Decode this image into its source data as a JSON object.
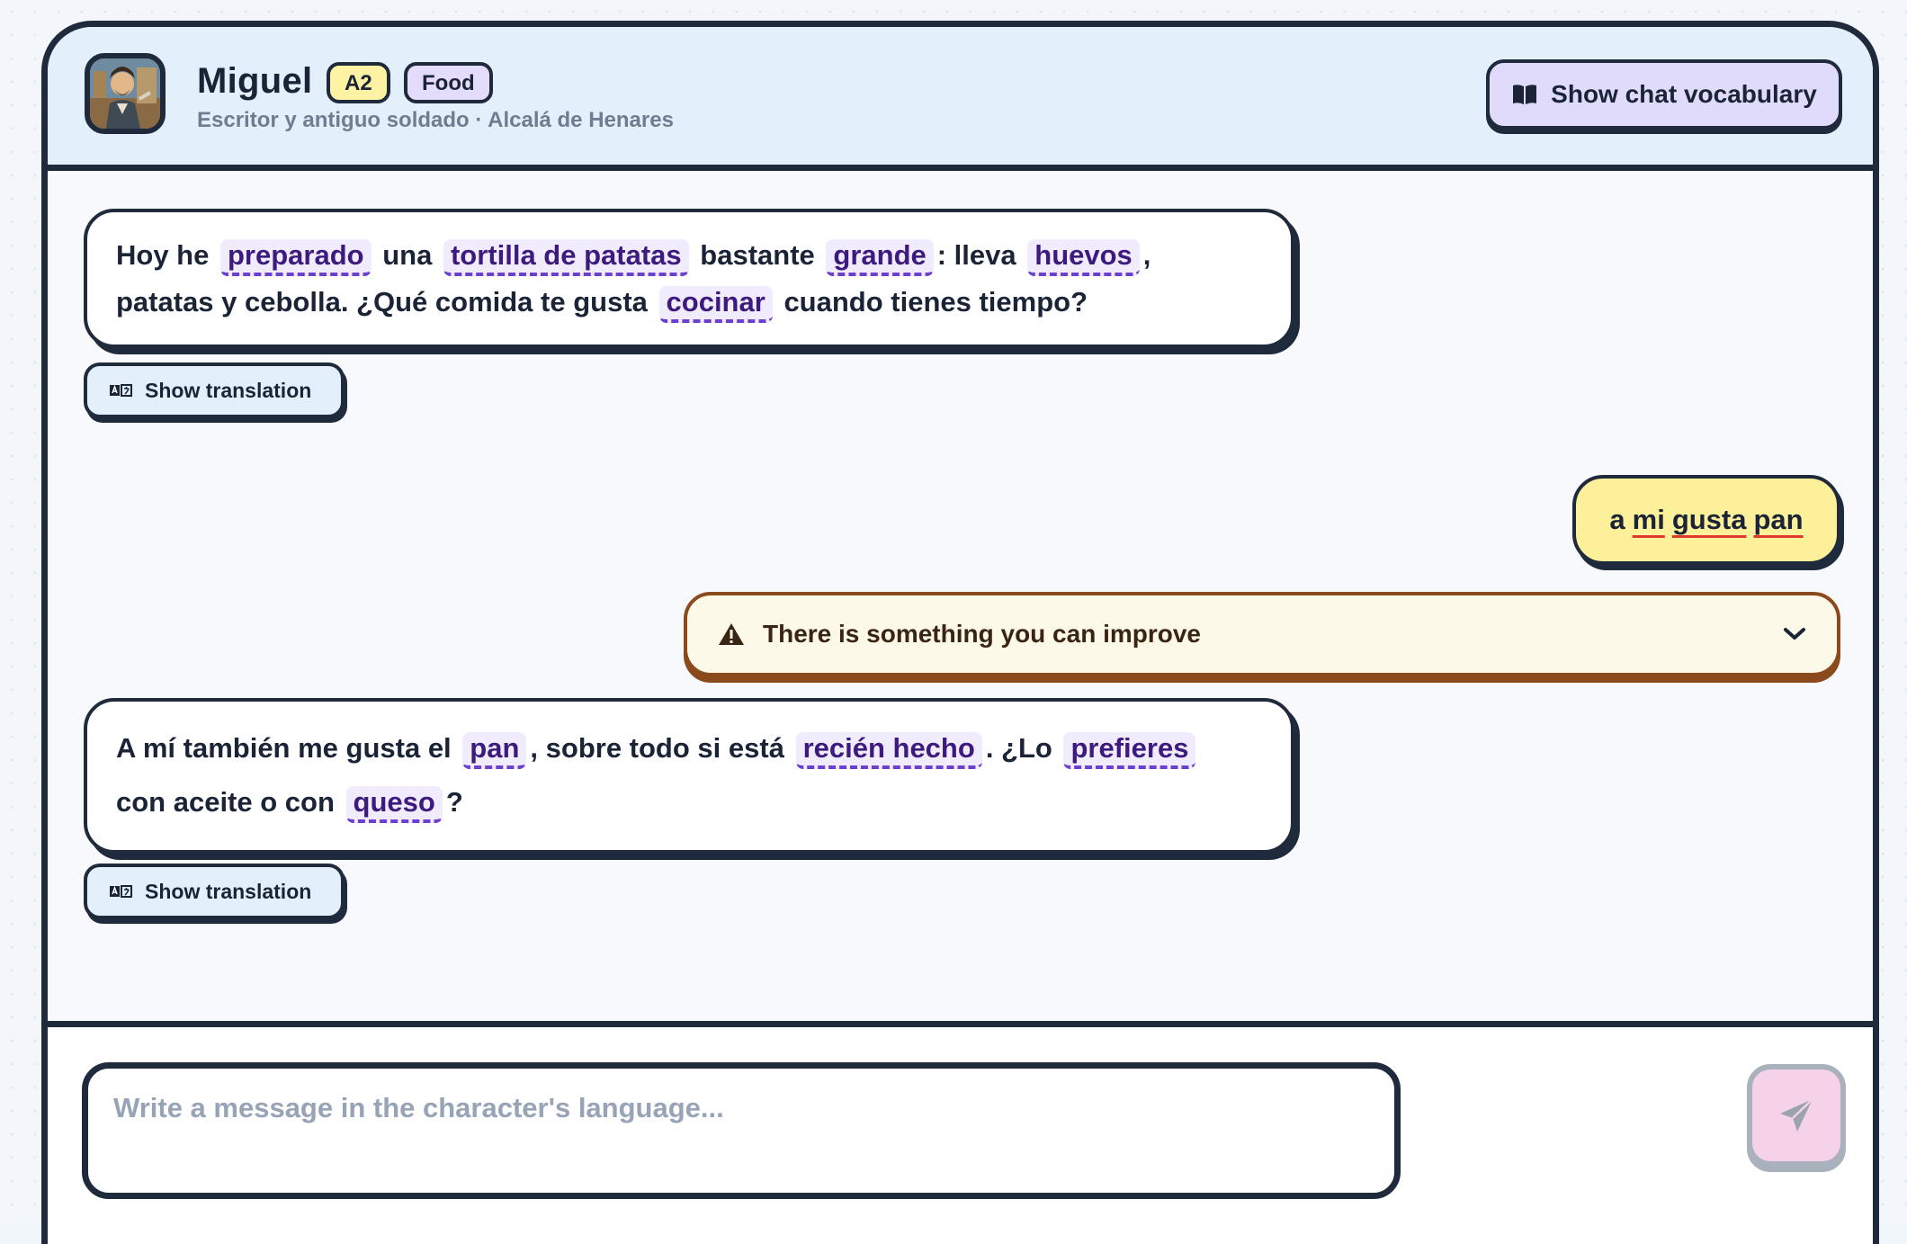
{
  "header": {
    "name": "Miguel",
    "level_badge": "A2",
    "topic_badge": "Food",
    "subtitle": "Escritor y antiguo soldado · Alcalá de Henares",
    "vocab_button": "Show chat vocabulary"
  },
  "messages": [
    {
      "role": "character",
      "segments": [
        {
          "text": "Hoy he",
          "vocab": false
        },
        {
          "text": "preparado",
          "vocab": true
        },
        {
          "text": "una",
          "vocab": false
        },
        {
          "text": "tortilla de patatas",
          "vocab": true
        },
        {
          "text": "bastante",
          "vocab": false
        },
        {
          "text": "grande",
          "vocab": true
        },
        {
          "text": ": lleva",
          "vocab": false
        },
        {
          "text": "huevos",
          "vocab": true
        },
        {
          "text": ",",
          "vocab": false
        },
        {
          "text": "patatas y cebolla. ¿Qué comida te gusta",
          "vocab": false
        },
        {
          "text": "cocinar",
          "vocab": true
        },
        {
          "text": "cuando tienes tiempo?",
          "vocab": false
        }
      ],
      "translation_button": "Show translation"
    },
    {
      "role": "user",
      "words": [
        "a",
        "mi",
        "gusta",
        "pan"
      ],
      "flagged_words": [
        "mi",
        "gusta",
        "pan"
      ]
    },
    {
      "role": "feedback",
      "text": "There is something you can improve"
    },
    {
      "role": "character",
      "segments": [
        {
          "text": "A mí también me gusta el",
          "vocab": false
        },
        {
          "text": "pan",
          "vocab": true
        },
        {
          "text": ", sobre todo si está",
          "vocab": false
        },
        {
          "text": "recién hecho",
          "vocab": true
        },
        {
          "text": ". ¿Lo",
          "vocab": false
        },
        {
          "text": "prefieres",
          "vocab": true
        },
        {
          "text": "con aceite o con",
          "vocab": false
        },
        {
          "text": "queso",
          "vocab": true
        },
        {
          "text": "?",
          "vocab": false
        }
      ],
      "translation_button": "Show translation"
    }
  ],
  "composer": {
    "placeholder": "Write a message in the character's language..."
  },
  "icons": {
    "vocab": "book-open-icon",
    "translation": "translate-icon",
    "warning": "warning-triangle-icon",
    "expand": "chevron-down-icon",
    "send": "paper-plane-icon"
  },
  "colors": {
    "header_bg": "#e3f0fb",
    "level_badge": "#fdf3a3",
    "topic_badge": "#e3dcfb",
    "vocab_button": "#e0dbfb",
    "user_bubble": "#fdf09a",
    "vocab_highlight": "#f0ebfd",
    "feedback_border": "#8a4a1c",
    "send_button": "#f5d2e8"
  }
}
